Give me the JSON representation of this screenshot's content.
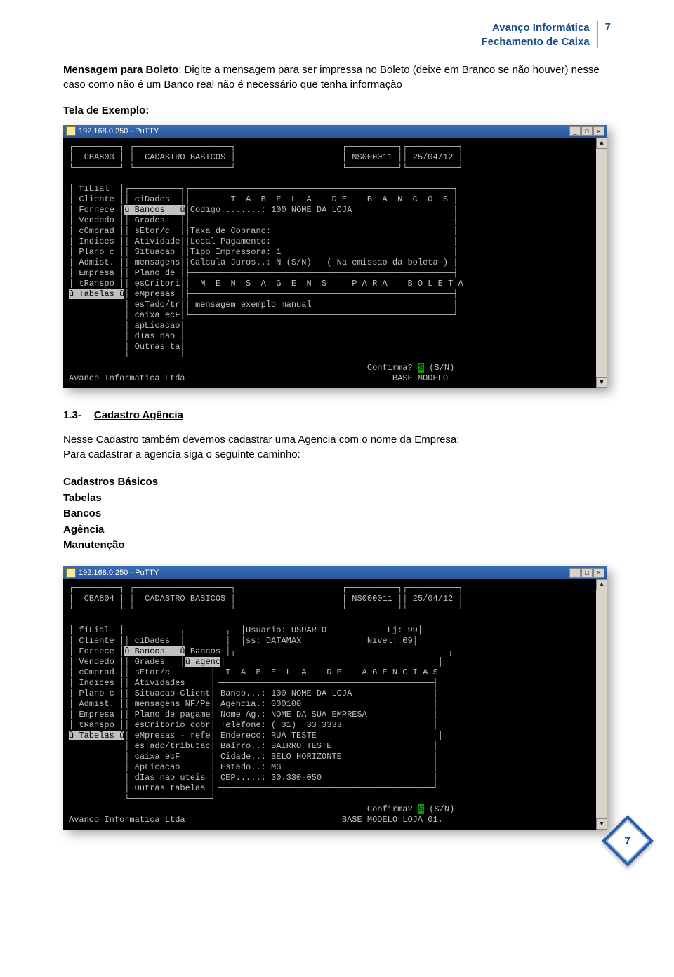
{
  "header": {
    "line1": "Avanço Informática",
    "line2": "Fechamento de Caixa",
    "page_num": "7"
  },
  "paragraph1": {
    "bold_lead": "Mensagem para  Boleto",
    "rest": ": Digite a mensagem para ser impressa no Boleto (deixe em Branco se não houver) nesse caso como não é um Banco real não é necessário que tenha informação"
  },
  "example_label": "Tela de Exemplo:",
  "putty1": {
    "title": "192.168.0.250 - PuTTY",
    "win_min": "_",
    "win_max": "□",
    "win_close": "×",
    "scroll_up": "▲",
    "scroll_down": "▼",
    "lines": {
      "top": "┌─────────┐ ┌───────────────────┐                     ┌──────────┐┌──────────┐",
      "hdr": "│  CBA803 │ │  CADASTRO BASICOS │                     │ NS000011 ││ 25/04/12 │",
      "topb": "└─────────┘ └───────────────────┘                     └──────────┘└──────────┘",
      "blank": "                                                                              ",
      "m1": "│ fiLial  │┌──────────┐┌────────────────────────────────────────────────────┐",
      "m2": "│ Cliente ││ ciDades  ││        T  A  B  E  L  A    D E    B  A  N  C  O  S │",
      "m3a": "│ Fornece │",
      "m3hl": "û Bancos   û",
      "m3b": "│Codigo........: 100 NOME DA LOJA                    │",
      "m4": "│ Vendedo ││ Grades   │├────────────────────────────────────────────────────┤",
      "m5": "│ cOmprad ││ sEtor/c  ││Taxa de Cobranc:                                    │",
      "m6": "│ Indices ││ Atividade││Local Pagamento:                                    │",
      "m7": "│ Plano c ││ Situacao ││Tipo Impressora: 1                                  │",
      "m8": "│ Admist. ││ mensagens││Calcula Juros..: N (S/N)   ( Na emissao da boleta ) │",
      "m9": "│ Empresa ││ Plano de │├────────────────────────────────────────────────────┤",
      "m10": "│ tRanspo ││ esCritori││  M  E  N  S  A  G  E  N  S     P A R A    B O L E T A",
      "m11a": "",
      "m11hl": "û Tabelas û",
      "m11b": "│ eMpresas │├────────────────────────────────────────────────────┤",
      "m12": "           │ esTado/tr││ mensagem exemplo manual                            │",
      "m13": "           │ caixa ecF│└────────────────────────────────────────────────────┘",
      "m14": "           │ apLicacao│                                                      ",
      "m15": "           │ dIas nao │                                                      ",
      "m16": "           │ Outras ta│                                                      ",
      "m17": "           └──────────┘                                                      ",
      "cf_a": "                                                           Confirma? ",
      "cf_s": "S",
      "cf_b": " (S/N)",
      "foot": "Avanco Informatica Ltda                                         BASE MODELO"
    }
  },
  "section": {
    "num": "1.3-",
    "title": "Cadastro Agência"
  },
  "paragraph2": "Nesse Cadastro também devemos cadastrar uma Agencia com o nome da Empresa:\nPara cadastrar a agencia siga o seguinte caminho:",
  "path": {
    "l1": "Cadastros Básicos",
    "l2": "Tabelas",
    "l3": "Bancos",
    "l4": "Agência",
    "l5": "Manutenção"
  },
  "putty2": {
    "title": "192.168.0.250 - PuTTY",
    "win_min": "_",
    "win_max": "□",
    "win_close": "×",
    "scroll_up": "▲",
    "scroll_down": "▼",
    "lines": {
      "top": "┌─────────┐ ┌───────────────────┐                     ┌──────────┐┌──────────┐",
      "hdr": "│  CBA804 │ │  CADASTRO BASICOS │                     │ NS000011 ││ 25/04/12 │",
      "topb": "└─────────┘ └───────────────────┘                     └──────────┘└──────────┘",
      "blank": "                                                                              ",
      "u1": "│ fiLial  │           ┌────────┐  │Usuario: USUARIO            Lj: 99│",
      "u2": "│ Cliente ││ ciDades  │        │  │ss: DATAMAX             Nivel: 09│",
      "u3a": "│ Fornece │",
      "u3hl": "û Bancos   û",
      "u3b": " Bancos │┌──────────────────────────────────────────┐",
      "u4a": "│ Vendedo ││ Grades   │",
      "u4hl": "û agenc",
      "u4b": "│                                          │",
      "u5": "│ cOmprad ││ sEtor/c        ││ T  A  B  E  L  A    D E    A G E N C I A S",
      "u6": "│ Indices ││ Atividades     │├──────────────────────────────────────────┤",
      "u7": "│ Plano c ││ Situacao Client││Banco...: 100 NOME DA LOJA                │",
      "u8": "│ Admist. ││ mensagens NF/Pe││Agencia.: 000100                          │",
      "u9": "│ Empresa ││ Plano de pagame││Nome Ag.: NOME DA SUA EMPRESA             │",
      "u10": "│ tRanspo ││ esCritorio cobr││Telefone: ( 31)  33.3333                  │",
      "u11a": "",
      "u11hl": "û Tabelas û",
      "u11b": "│ eMpresas - refe││Endereco: RUA TESTE                        │",
      "u12": "           │ esTado/tributac││Bairro..: BAIRRO TESTE                    │",
      "u13": "           │ caixa ecF      ││Cidade..: BELO HORIZONTE                  │",
      "u14": "           │ apLicacao      ││Estado..: MG                              │",
      "u15": "           │ dIas nao uteis ││CEP.....: 30.330-050                      │",
      "u16": "           │ Outras tabelas │└──────────────────────────────────────────┘",
      "u17": "           └────────────────┘                                           ",
      "cf_a": "                                                           Confirma? ",
      "cf_s": "S",
      "cf_b": " (S/N)",
      "foot": "Avanco Informatica Ltda                               BASE MODELO LOJA 01."
    }
  },
  "footer_badge": "7"
}
